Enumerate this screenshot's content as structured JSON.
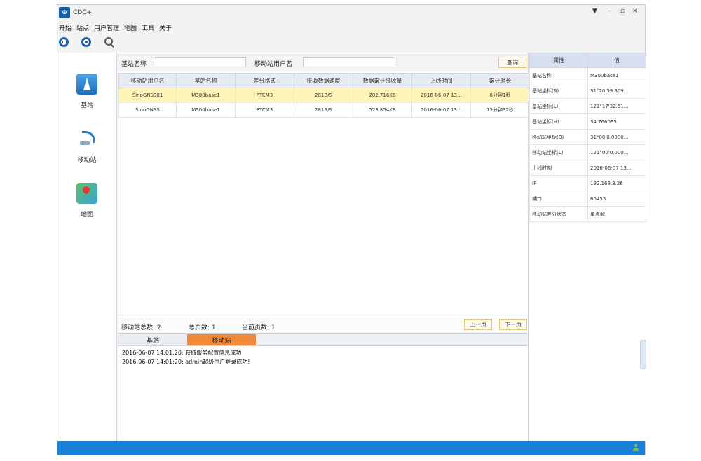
{
  "window": {
    "title": "CDC+",
    "logo_text": "⊕"
  },
  "window_controls": [
    "▼",
    "–",
    "▫",
    "×"
  ],
  "menu": [
    "开始",
    "站点",
    "用户管理",
    "地图",
    "工具",
    "关于"
  ],
  "left_nav": [
    {
      "label": "基站",
      "icon": "base-station-icon"
    },
    {
      "label": "移动站",
      "icon": "rover-station-icon"
    },
    {
      "label": "地图",
      "icon": "map-icon"
    }
  ],
  "search": {
    "base_name_label": "基站名称",
    "base_name_value": "",
    "rover_user_label": "移动站用户名",
    "rover_user_value": "",
    "query_button": "查询"
  },
  "table": {
    "headers": [
      "移动站用户名",
      "基站名称",
      "差分格式",
      "接收数据速度",
      "数据累计接收量",
      "上线时间",
      "累计时长"
    ],
    "rows": [
      [
        "SinoGNSS01",
        "M300base1",
        "RTCM3",
        "281B/S",
        "202.716KB",
        "2016-06-07 13…",
        "6分钟1秒"
      ],
      [
        "SinoGNSS",
        "M300base1",
        "RTCM3",
        "281B/S",
        "523.854KB",
        "2016-06-07 13…",
        "15分钟32秒"
      ]
    ],
    "selected_row": 0
  },
  "status": {
    "total_label": "移动站总数: 2",
    "pages_label": "总页数: 1",
    "current_label": "当前页数: 1",
    "prev": "上一页",
    "next": "下一页"
  },
  "bottom_tabs": {
    "tab1": "基站",
    "tab2": "移动站",
    "active": "移动站"
  },
  "log": [
    "2016-06-07 14:01:20: 获取服务配置信息成功",
    "2016-06-07 14:01:20: admin超级用户登录成功!"
  ],
  "properties": {
    "headers": [
      "属性",
      "值"
    ],
    "rows": [
      [
        "基站名称",
        "M300base1"
      ],
      [
        "基站坐标(B)",
        "31°20'59.809…"
      ],
      [
        "基站坐标(L)",
        "121°17'32.51…"
      ],
      [
        "基站坐标(H)",
        "34.766035"
      ],
      [
        "移动站坐标(B)",
        "31°00'0.0000…"
      ],
      [
        "移动站坐标(L)",
        "121°00'0.000…"
      ],
      [
        "上线时刻",
        "2016-06-07 13…"
      ],
      [
        "IP",
        "192.168.3.26"
      ],
      [
        "端口",
        "60453"
      ],
      [
        "移动站差分状态",
        "单点解"
      ]
    ]
  }
}
